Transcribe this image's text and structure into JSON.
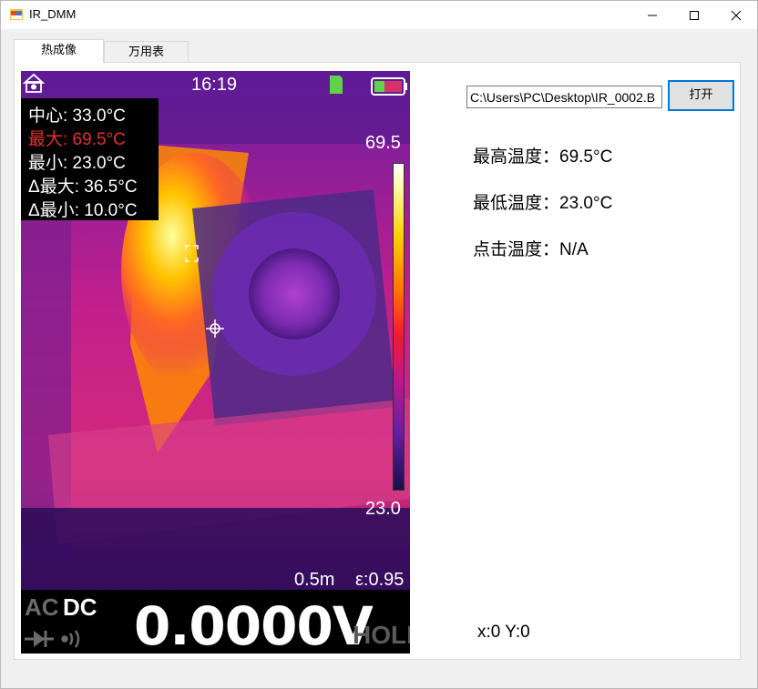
{
  "window": {
    "title": "IR_DMM",
    "icon": "app-window-icon",
    "controls": [
      "minimize-icon",
      "maximize-icon",
      "close-icon"
    ]
  },
  "tabs": [
    {
      "label": "热成像",
      "active": true
    },
    {
      "label": "万用表",
      "active": false
    }
  ],
  "thermal": {
    "time": "16:19",
    "stats": {
      "center": "中心: 33.0°C",
      "max": "最大: 69.5°C",
      "min": "最小: 23.0°C",
      "delta_max": "Δ最大: 36.5°C",
      "delta_min": "Δ最小: 10.0°C"
    },
    "scale_max": "69.5",
    "scale_min": "23.0",
    "distance": "0.5m",
    "emissivity": "ε:0.95",
    "mode_ac": "AC",
    "mode_dc": "DC",
    "reading": "0.0000V",
    "hold": "HOLD",
    "icons": [
      "home-camera-icon",
      "sd-card-icon",
      "battery-icon",
      "diode-icon",
      "continuity-icon",
      "crosshair-icon",
      "focus-bracket-icon"
    ],
    "colors": {
      "max_text": "#e0322c",
      "sd_card": "#5fd34a",
      "battery": "#d6336c"
    }
  },
  "file": {
    "path": "C:\\Users\\PC\\Desktop\\IR_0002.B",
    "open_label": "打开"
  },
  "info": {
    "max_temp": "最高温度：69.5°C",
    "min_temp": "最低温度：23.0°C",
    "click_temp": "点击温度：N/A"
  },
  "coords": "x:0 Y:0"
}
